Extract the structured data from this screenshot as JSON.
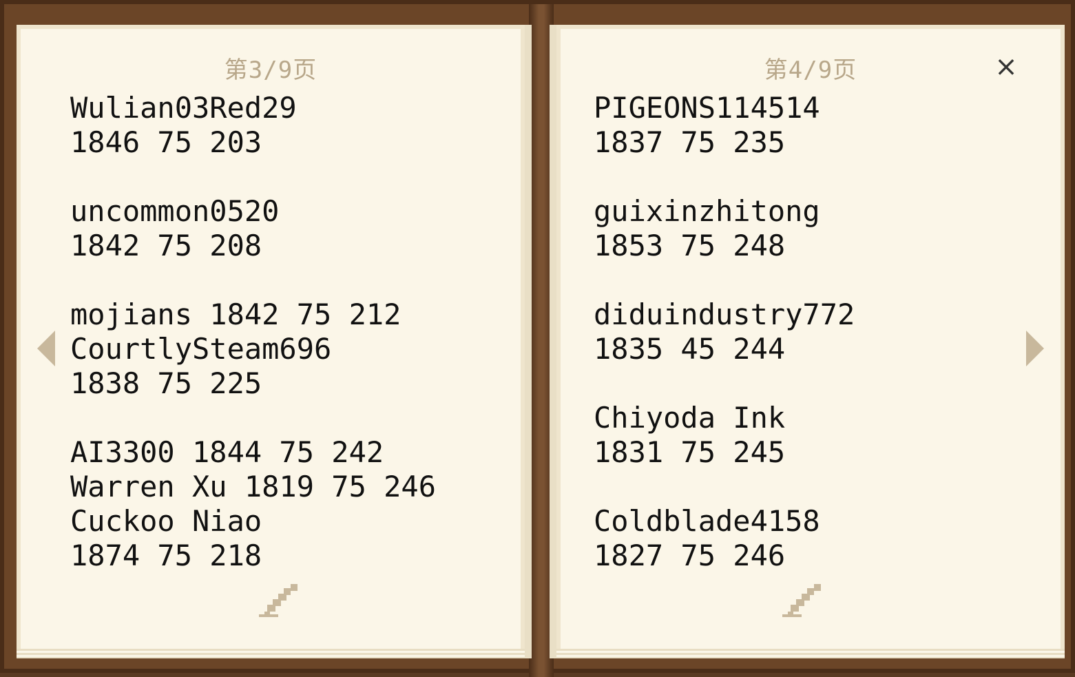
{
  "book": {
    "left_page": {
      "page_number": "第3/9页",
      "text": "Wulian03Red29\n1846 75 203\n\nuncommon0520\n1842 75 208\n\nmojians 1842 75 212\nCourtlySteam696\n1838 75 225\n\nAI3300 1844 75 242\nWarren Xu 1819 75 246\nCuckoo Niao\n1874 75 218"
    },
    "right_page": {
      "page_number": "第4/9页",
      "text": "PIGEONS114514\n1837 75 235\n\nguixinzhitong\n1853 75 248\n\ndiduindustry772\n1835 45 244\n\nChiyoda Ink\n1831 75 245\n\nColdblade4158\n1827 75 246"
    },
    "controls": {
      "close_label": "×"
    },
    "icons": {
      "prev": "arrow-left-icon",
      "next": "arrow-right-icon",
      "edit": "quill-pen-icon",
      "close": "close-icon"
    },
    "colors": {
      "paper": "#fbf6e8",
      "cover": "#6b4527",
      "page_number": "#b8a78a",
      "text": "#111111",
      "arrow": "#c8b89c"
    }
  }
}
